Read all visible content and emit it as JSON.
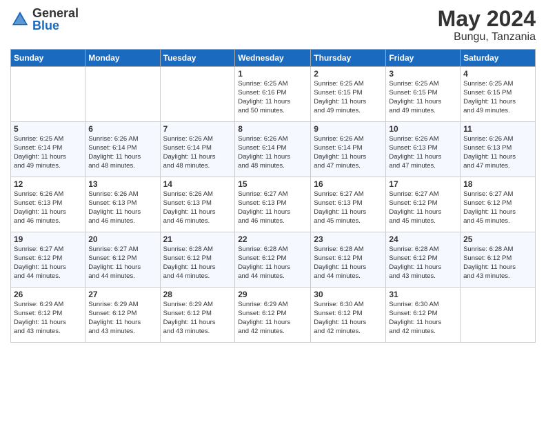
{
  "logo": {
    "general": "General",
    "blue": "Blue"
  },
  "header": {
    "month_year": "May 2024",
    "location": "Bungu, Tanzania"
  },
  "weekdays": [
    "Sunday",
    "Monday",
    "Tuesday",
    "Wednesday",
    "Thursday",
    "Friday",
    "Saturday"
  ],
  "weeks": [
    [
      {
        "day": "",
        "info": ""
      },
      {
        "day": "",
        "info": ""
      },
      {
        "day": "",
        "info": ""
      },
      {
        "day": "1",
        "info": "Sunrise: 6:25 AM\nSunset: 6:16 PM\nDaylight: 11 hours\nand 50 minutes."
      },
      {
        "day": "2",
        "info": "Sunrise: 6:25 AM\nSunset: 6:15 PM\nDaylight: 11 hours\nand 49 minutes."
      },
      {
        "day": "3",
        "info": "Sunrise: 6:25 AM\nSunset: 6:15 PM\nDaylight: 11 hours\nand 49 minutes."
      },
      {
        "day": "4",
        "info": "Sunrise: 6:25 AM\nSunset: 6:15 PM\nDaylight: 11 hours\nand 49 minutes."
      }
    ],
    [
      {
        "day": "5",
        "info": "Sunrise: 6:25 AM\nSunset: 6:14 PM\nDaylight: 11 hours\nand 49 minutes."
      },
      {
        "day": "6",
        "info": "Sunrise: 6:26 AM\nSunset: 6:14 PM\nDaylight: 11 hours\nand 48 minutes."
      },
      {
        "day": "7",
        "info": "Sunrise: 6:26 AM\nSunset: 6:14 PM\nDaylight: 11 hours\nand 48 minutes."
      },
      {
        "day": "8",
        "info": "Sunrise: 6:26 AM\nSunset: 6:14 PM\nDaylight: 11 hours\nand 48 minutes."
      },
      {
        "day": "9",
        "info": "Sunrise: 6:26 AM\nSunset: 6:14 PM\nDaylight: 11 hours\nand 47 minutes."
      },
      {
        "day": "10",
        "info": "Sunrise: 6:26 AM\nSunset: 6:13 PM\nDaylight: 11 hours\nand 47 minutes."
      },
      {
        "day": "11",
        "info": "Sunrise: 6:26 AM\nSunset: 6:13 PM\nDaylight: 11 hours\nand 47 minutes."
      }
    ],
    [
      {
        "day": "12",
        "info": "Sunrise: 6:26 AM\nSunset: 6:13 PM\nDaylight: 11 hours\nand 46 minutes."
      },
      {
        "day": "13",
        "info": "Sunrise: 6:26 AM\nSunset: 6:13 PM\nDaylight: 11 hours\nand 46 minutes."
      },
      {
        "day": "14",
        "info": "Sunrise: 6:26 AM\nSunset: 6:13 PM\nDaylight: 11 hours\nand 46 minutes."
      },
      {
        "day": "15",
        "info": "Sunrise: 6:27 AM\nSunset: 6:13 PM\nDaylight: 11 hours\nand 46 minutes."
      },
      {
        "day": "16",
        "info": "Sunrise: 6:27 AM\nSunset: 6:13 PM\nDaylight: 11 hours\nand 45 minutes."
      },
      {
        "day": "17",
        "info": "Sunrise: 6:27 AM\nSunset: 6:12 PM\nDaylight: 11 hours\nand 45 minutes."
      },
      {
        "day": "18",
        "info": "Sunrise: 6:27 AM\nSunset: 6:12 PM\nDaylight: 11 hours\nand 45 minutes."
      }
    ],
    [
      {
        "day": "19",
        "info": "Sunrise: 6:27 AM\nSunset: 6:12 PM\nDaylight: 11 hours\nand 44 minutes."
      },
      {
        "day": "20",
        "info": "Sunrise: 6:27 AM\nSunset: 6:12 PM\nDaylight: 11 hours\nand 44 minutes."
      },
      {
        "day": "21",
        "info": "Sunrise: 6:28 AM\nSunset: 6:12 PM\nDaylight: 11 hours\nand 44 minutes."
      },
      {
        "day": "22",
        "info": "Sunrise: 6:28 AM\nSunset: 6:12 PM\nDaylight: 11 hours\nand 44 minutes."
      },
      {
        "day": "23",
        "info": "Sunrise: 6:28 AM\nSunset: 6:12 PM\nDaylight: 11 hours\nand 44 minutes."
      },
      {
        "day": "24",
        "info": "Sunrise: 6:28 AM\nSunset: 6:12 PM\nDaylight: 11 hours\nand 43 minutes."
      },
      {
        "day": "25",
        "info": "Sunrise: 6:28 AM\nSunset: 6:12 PM\nDaylight: 11 hours\nand 43 minutes."
      }
    ],
    [
      {
        "day": "26",
        "info": "Sunrise: 6:29 AM\nSunset: 6:12 PM\nDaylight: 11 hours\nand 43 minutes."
      },
      {
        "day": "27",
        "info": "Sunrise: 6:29 AM\nSunset: 6:12 PM\nDaylight: 11 hours\nand 43 minutes."
      },
      {
        "day": "28",
        "info": "Sunrise: 6:29 AM\nSunset: 6:12 PM\nDaylight: 11 hours\nand 43 minutes."
      },
      {
        "day": "29",
        "info": "Sunrise: 6:29 AM\nSunset: 6:12 PM\nDaylight: 11 hours\nand 42 minutes."
      },
      {
        "day": "30",
        "info": "Sunrise: 6:30 AM\nSunset: 6:12 PM\nDaylight: 11 hours\nand 42 minutes."
      },
      {
        "day": "31",
        "info": "Sunrise: 6:30 AM\nSunset: 6:12 PM\nDaylight: 11 hours\nand 42 minutes."
      },
      {
        "day": "",
        "info": ""
      }
    ]
  ]
}
